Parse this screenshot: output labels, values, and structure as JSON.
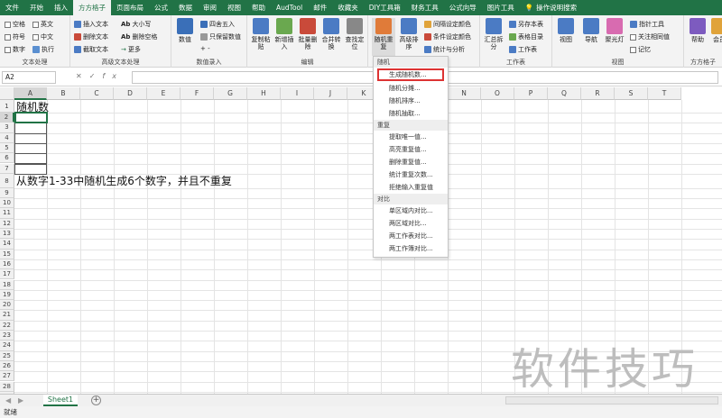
{
  "tabs": [
    "文件",
    "开始",
    "插入",
    "方方格子",
    "页面布局",
    "公式",
    "数据",
    "审阅",
    "视图",
    "帮助",
    "AudTool",
    "邮件",
    "收藏夹",
    "DIY工具箱",
    "财务工具",
    "公式向导",
    "图片工具"
  ],
  "active_tab_index": 3,
  "tell_me": "操作说明搜索",
  "ribbon": {
    "text_processing": {
      "checkboxes": [
        "空格",
        "英文",
        "符号",
        "中文",
        "数字",
        "执行"
      ],
      "label": "文本处理"
    },
    "advanced_text": {
      "buttons": [
        "插入文本",
        "删除文本",
        "截取文本",
        "大小写",
        "删除空格",
        "更多"
      ],
      "label": "高级文本处理"
    },
    "number_entry": {
      "buttons": [
        "数值",
        "四舍五入",
        "只保留数值",
        "+ -"
      ],
      "label": "数值录入"
    },
    "edit": {
      "buttons": [
        "复制粘贴",
        "新增插入",
        "批量删除",
        "合并转换",
        "查找定位"
      ],
      "label": "编辑"
    },
    "random": {
      "buttons": [
        "随机重复",
        "高级排序"
      ],
      "small": [
        "间隔设定颜色",
        "条件设定颜色",
        "统计与分析"
      ]
    },
    "workbook": {
      "buttons": [
        "汇总拆分"
      ],
      "small": [
        "另存本表",
        "表格目录",
        "工作表"
      ],
      "label": "工作表"
    },
    "view": {
      "buttons": [
        "视图",
        "导航",
        "聚光灯"
      ],
      "small": [
        "指针工具",
        "关注相同值",
        "记忆"
      ],
      "label": "视图"
    },
    "help": {
      "buttons": [
        "帮助",
        "会员"
      ],
      "label": "方方格子"
    }
  },
  "name_box": "A2",
  "formula_value": "",
  "columns": [
    "A",
    "B",
    "C",
    "D",
    "E",
    "F",
    "G",
    "H",
    "I",
    "J",
    "K",
    "L",
    "M",
    "N",
    "O",
    "P",
    "Q",
    "R",
    "S",
    "T"
  ],
  "rows": [
    "1",
    "2",
    "3",
    "4",
    "5",
    "6",
    "7",
    "8",
    "9",
    "10",
    "11",
    "12",
    "13",
    "14",
    "15",
    "16",
    "17",
    "18",
    "19",
    "20",
    "21",
    "22",
    "23",
    "24",
    "25",
    "26",
    "27",
    "28",
    "29"
  ],
  "cells": {
    "A1": "随机数",
    "A8": "从数字1-33中随机生成6个数字，并且不重复"
  },
  "menu": {
    "sections": [
      {
        "title": "随机",
        "items": [
          "生成随机数...",
          "随机分摊...",
          "随机排序...",
          "随机抽取..."
        ]
      },
      {
        "title": "重复",
        "items": [
          "提取唯一值...",
          "高亮重复值...",
          "删除重复值...",
          "统计重复次数...",
          "拒绝输入重复值"
        ]
      },
      {
        "title": "对比",
        "items": [
          "单区域内对比...",
          "两区域对比...",
          "两工作表对比...",
          "两工作簿对比..."
        ]
      }
    ],
    "highlighted": "生成随机数..."
  },
  "sheet_tab": "Sheet1",
  "status": "就绪",
  "watermark": "软件技巧",
  "colors": {
    "accent": "#217346",
    "highlight_border": "#dd3333"
  }
}
